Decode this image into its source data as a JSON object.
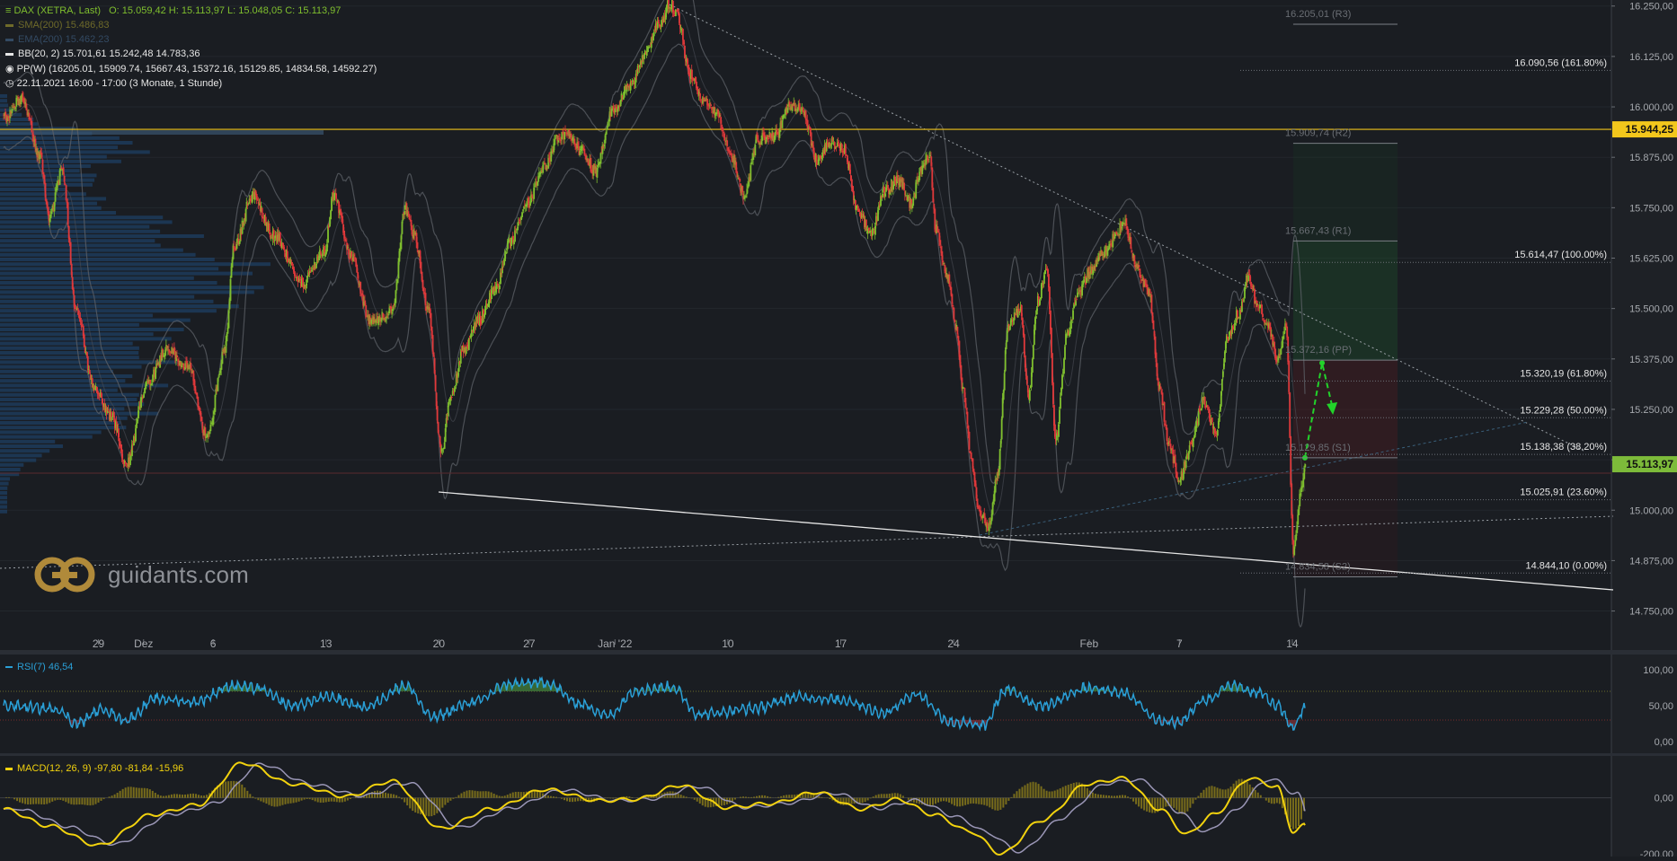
{
  "header": {
    "main": "DAX (XETRA, Last)",
    "ohlc": "O: 15.059,42  H: 15.113,97  L: 15.048,05  C: 15.113,97",
    "sma": "SMA(200)  15.486,83",
    "ema": "EMA(200)  15.462,23",
    "bb": "BB(20, 2)  15.701,61  15.242,48  14.783,36",
    "pp": "PP(W)  (16205.01, 15909.74, 15667.43, 15372.16, 15129.85, 14834.58, 14592.27)",
    "time": "22.11.2021 16:00 - 17:00   (3 Monate, 1 Stunde)"
  },
  "colors": {
    "bg": "#1a1d22",
    "up": "#7fbf2e",
    "down": "#e0393b",
    "gold": "#f0c419",
    "rsi": "#2a9fd6",
    "macd": "#f2d20e",
    "signal": "#9a96b6",
    "green_tag": "#7dbb3a",
    "gold_tag": "#f2c71c"
  },
  "logo": {
    "text": "guidants.com",
    "icon": "guidants-logo-icon"
  },
  "chart_data": [
    {
      "type": "candlestick",
      "title": "DAX (XETRA, Last)",
      "ylim": [
        14680,
        16265
      ],
      "yticks": [
        "16.250,00",
        "16.125,00",
        "16.000,00",
        "15.875,00",
        "15.750,00",
        "15.625,00",
        "15.500,00",
        "15.375,00",
        "15.250,00",
        "15.125,00",
        "15.000,00",
        "14.875,00",
        "14.750,00"
      ],
      "ytick_values": [
        16250,
        16125,
        16000,
        15875,
        15750,
        15625,
        15500,
        15375,
        15250,
        15125,
        15000,
        14875,
        14750
      ],
      "xticks": [
        "29",
        "Dez",
        "6",
        "13",
        "20",
        "27",
        "Jan '22",
        "10",
        "17",
        "24",
        "Feb",
        "7",
        "14"
      ],
      "xtick_index": [
        105,
        155,
        232,
        357,
        482,
        582,
        677,
        802,
        927,
        1052,
        1202,
        1302,
        1427
      ],
      "key_points": [
        {
          "i": 0,
          "v": 15970
        },
        {
          "i": 20,
          "v": 16020
        },
        {
          "i": 40,
          "v": 15880
        },
        {
          "i": 50,
          "v": 15730
        },
        {
          "i": 65,
          "v": 15840
        },
        {
          "i": 80,
          "v": 15500
        },
        {
          "i": 100,
          "v": 15300
        },
        {
          "i": 120,
          "v": 15230
        },
        {
          "i": 135,
          "v": 15110
        },
        {
          "i": 160,
          "v": 15320
        },
        {
          "i": 180,
          "v": 15400
        },
        {
          "i": 205,
          "v": 15350
        },
        {
          "i": 225,
          "v": 15180
        },
        {
          "i": 245,
          "v": 15400
        },
        {
          "i": 255,
          "v": 15650
        },
        {
          "i": 275,
          "v": 15780
        },
        {
          "i": 300,
          "v": 15680
        },
        {
          "i": 330,
          "v": 15560
        },
        {
          "i": 355,
          "v": 15640
        },
        {
          "i": 365,
          "v": 15780
        },
        {
          "i": 385,
          "v": 15630
        },
        {
          "i": 405,
          "v": 15470
        },
        {
          "i": 430,
          "v": 15490
        },
        {
          "i": 445,
          "v": 15750
        },
        {
          "i": 455,
          "v": 15680
        },
        {
          "i": 470,
          "v": 15500
        },
        {
          "i": 485,
          "v": 15140
        },
        {
          "i": 495,
          "v": 15290
        },
        {
          "i": 510,
          "v": 15400
        },
        {
          "i": 525,
          "v": 15470
        },
        {
          "i": 545,
          "v": 15550
        },
        {
          "i": 560,
          "v": 15660
        },
        {
          "i": 580,
          "v": 15760
        },
        {
          "i": 600,
          "v": 15850
        },
        {
          "i": 612,
          "v": 15920
        },
        {
          "i": 625,
          "v": 15930
        },
        {
          "i": 640,
          "v": 15890
        },
        {
          "i": 655,
          "v": 15840
        },
        {
          "i": 675,
          "v": 15990
        },
        {
          "i": 695,
          "v": 16060
        },
        {
          "i": 710,
          "v": 16130
        },
        {
          "i": 725,
          "v": 16200
        },
        {
          "i": 738,
          "v": 16260
        },
        {
          "i": 745,
          "v": 16230
        },
        {
          "i": 760,
          "v": 16080
        },
        {
          "i": 775,
          "v": 16020
        },
        {
          "i": 790,
          "v": 15980
        },
        {
          "i": 805,
          "v": 15880
        },
        {
          "i": 820,
          "v": 15780
        },
        {
          "i": 835,
          "v": 15920
        },
        {
          "i": 855,
          "v": 15930
        },
        {
          "i": 870,
          "v": 16000
        },
        {
          "i": 885,
          "v": 15990
        },
        {
          "i": 900,
          "v": 15870
        },
        {
          "i": 915,
          "v": 15910
        },
        {
          "i": 930,
          "v": 15900
        },
        {
          "i": 945,
          "v": 15750
        },
        {
          "i": 960,
          "v": 15680
        },
        {
          "i": 975,
          "v": 15790
        },
        {
          "i": 990,
          "v": 15820
        },
        {
          "i": 1005,
          "v": 15760
        },
        {
          "i": 1015,
          "v": 15840
        },
        {
          "i": 1025,
          "v": 15880
        },
        {
          "i": 1032,
          "v": 15700
        },
        {
          "i": 1045,
          "v": 15580
        },
        {
          "i": 1055,
          "v": 15450
        },
        {
          "i": 1062,
          "v": 15300
        },
        {
          "i": 1072,
          "v": 15120
        },
        {
          "i": 1080,
          "v": 15000
        },
        {
          "i": 1090,
          "v": 14960
        },
        {
          "i": 1100,
          "v": 15080
        },
        {
          "i": 1112,
          "v": 15450
        },
        {
          "i": 1125,
          "v": 15500
        },
        {
          "i": 1135,
          "v": 15280
        },
        {
          "i": 1145,
          "v": 15520
        },
        {
          "i": 1155,
          "v": 15600
        },
        {
          "i": 1165,
          "v": 15180
        },
        {
          "i": 1178,
          "v": 15440
        },
        {
          "i": 1190,
          "v": 15540
        },
        {
          "i": 1205,
          "v": 15600
        },
        {
          "i": 1218,
          "v": 15640
        },
        {
          "i": 1232,
          "v": 15680
        },
        {
          "i": 1240,
          "v": 15720
        },
        {
          "i": 1255,
          "v": 15600
        },
        {
          "i": 1268,
          "v": 15540
        },
        {
          "i": 1280,
          "v": 15300
        },
        {
          "i": 1290,
          "v": 15160
        },
        {
          "i": 1302,
          "v": 15080
        },
        {
          "i": 1315,
          "v": 15160
        },
        {
          "i": 1328,
          "v": 15270
        },
        {
          "i": 1342,
          "v": 15190
        },
        {
          "i": 1355,
          "v": 15430
        },
        {
          "i": 1368,
          "v": 15490
        },
        {
          "i": 1378,
          "v": 15580
        },
        {
          "i": 1388,
          "v": 15510
        },
        {
          "i": 1400,
          "v": 15460
        },
        {
          "i": 1410,
          "v": 15370
        },
        {
          "i": 1420,
          "v": 15460
        },
        {
          "i": 1428,
          "v": 14890
        },
        {
          "i": 1436,
          "v": 15040
        },
        {
          "i": 1441,
          "v": 15114
        }
      ],
      "bands_offset": 210,
      "fibonacci": [
        {
          "label": "16.090,56 (161.80%)",
          "value": 16090.56
        },
        {
          "label": "15.614,47 (100.00%)",
          "value": 15614.47
        },
        {
          "label": "15.320,19 (61.80%)",
          "value": 15320.19
        },
        {
          "label": "15.229,28 (50.00%)",
          "value": 15229.28
        },
        {
          "label": "15.138,38 (38.20%)",
          "value": 15138.38
        },
        {
          "label": "15.025,91 (23.60%)",
          "value": 15025.91
        },
        {
          "label": "14.844,10 (0.00%)",
          "value": 14844.1
        }
      ],
      "pivots": [
        {
          "label": "16.205,01 (R3)",
          "value": 16205.01
        },
        {
          "label": "15.909,74 (R2)",
          "value": 15909.74
        },
        {
          "label": "15.667,43 (R1)",
          "value": 15667.43
        },
        {
          "label": "15.372,16 (PP)",
          "value": 15372.16
        },
        {
          "label": "15.129,85 (S1)",
          "value": 15129.85
        },
        {
          "label": "14.834,58 (S2)",
          "value": 14834.58
        }
      ],
      "horizontal_line": {
        "value": 15944.25,
        "label": "15.944,25"
      },
      "last_price": {
        "value": 15113.97,
        "label": "15.113,97"
      },
      "forecast_arrow": [
        {
          "i": 1441,
          "v": 15130
        },
        {
          "i": 1460,
          "v": 15365
        },
        {
          "i": 1472,
          "v": 15250
        }
      ]
    },
    {
      "type": "line",
      "name": "RSI(7)",
      "title": "RSI(7)  46,54",
      "ylim": [
        -15,
        120
      ],
      "yticks": [
        "100,00",
        "50,00",
        "0,00"
      ],
      "ytick_values": [
        100,
        50,
        0
      ],
      "levels": [
        70,
        30
      ],
      "key_points": [
        {
          "i": 0,
          "v": 50
        },
        {
          "i": 60,
          "v": 45
        },
        {
          "i": 80,
          "v": 25
        },
        {
          "i": 110,
          "v": 45
        },
        {
          "i": 135,
          "v": 30
        },
        {
          "i": 170,
          "v": 60
        },
        {
          "i": 210,
          "v": 55
        },
        {
          "i": 255,
          "v": 78
        },
        {
          "i": 280,
          "v": 74
        },
        {
          "i": 320,
          "v": 50
        },
        {
          "i": 360,
          "v": 62
        },
        {
          "i": 400,
          "v": 48
        },
        {
          "i": 445,
          "v": 78
        },
        {
          "i": 475,
          "v": 34
        },
        {
          "i": 520,
          "v": 55
        },
        {
          "i": 560,
          "v": 80
        },
        {
          "i": 600,
          "v": 82
        },
        {
          "i": 640,
          "v": 52
        },
        {
          "i": 670,
          "v": 36
        },
        {
          "i": 700,
          "v": 72
        },
        {
          "i": 740,
          "v": 76
        },
        {
          "i": 770,
          "v": 38
        },
        {
          "i": 830,
          "v": 46
        },
        {
          "i": 880,
          "v": 62
        },
        {
          "i": 930,
          "v": 58
        },
        {
          "i": 975,
          "v": 40
        },
        {
          "i": 1010,
          "v": 66
        },
        {
          "i": 1050,
          "v": 27
        },
        {
          "i": 1085,
          "v": 22
        },
        {
          "i": 1110,
          "v": 72
        },
        {
          "i": 1150,
          "v": 50
        },
        {
          "i": 1200,
          "v": 74
        },
        {
          "i": 1240,
          "v": 68
        },
        {
          "i": 1280,
          "v": 30
        },
        {
          "i": 1300,
          "v": 26
        },
        {
          "i": 1330,
          "v": 58
        },
        {
          "i": 1360,
          "v": 78
        },
        {
          "i": 1390,
          "v": 68
        },
        {
          "i": 1410,
          "v": 50
        },
        {
          "i": 1428,
          "v": 20
        },
        {
          "i": 1441,
          "v": 46.54
        }
      ]
    },
    {
      "type": "line",
      "name": "MACD(12, 26, 9)",
      "title": "MACD(12, 26, 9)  -97,80  -81,84  -15,96",
      "ylim": [
        -210,
        150
      ],
      "yticks": [
        "0,00",
        "-200,00"
      ],
      "ytick_values": [
        0,
        -200
      ],
      "key_points": [
        {
          "i": 0,
          "v": -40
        },
        {
          "i": 50,
          "v": -100
        },
        {
          "i": 105,
          "v": -170
        },
        {
          "i": 165,
          "v": -60
        },
        {
          "i": 215,
          "v": -25
        },
        {
          "i": 265,
          "v": 125
        },
        {
          "i": 320,
          "v": 50
        },
        {
          "i": 380,
          "v": 5
        },
        {
          "i": 430,
          "v": 60
        },
        {
          "i": 485,
          "v": -110
        },
        {
          "i": 540,
          "v": -40
        },
        {
          "i": 600,
          "v": 30
        },
        {
          "i": 660,
          "v": -10
        },
        {
          "i": 700,
          "v": -5
        },
        {
          "i": 750,
          "v": 45
        },
        {
          "i": 800,
          "v": -35
        },
        {
          "i": 850,
          "v": -20
        },
        {
          "i": 900,
          "v": 20
        },
        {
          "i": 950,
          "v": -40
        },
        {
          "i": 990,
          "v": -5
        },
        {
          "i": 1030,
          "v": -60
        },
        {
          "i": 1070,
          "v": -120
        },
        {
          "i": 1105,
          "v": -200
        },
        {
          "i": 1150,
          "v": -80
        },
        {
          "i": 1200,
          "v": 50
        },
        {
          "i": 1240,
          "v": 70
        },
        {
          "i": 1280,
          "v": -40
        },
        {
          "i": 1310,
          "v": -130
        },
        {
          "i": 1340,
          "v": -60
        },
        {
          "i": 1380,
          "v": 70
        },
        {
          "i": 1410,
          "v": 40
        },
        {
          "i": 1428,
          "v": -120
        },
        {
          "i": 1441,
          "v": -97.8
        }
      ],
      "signal_lag": 22
    }
  ]
}
